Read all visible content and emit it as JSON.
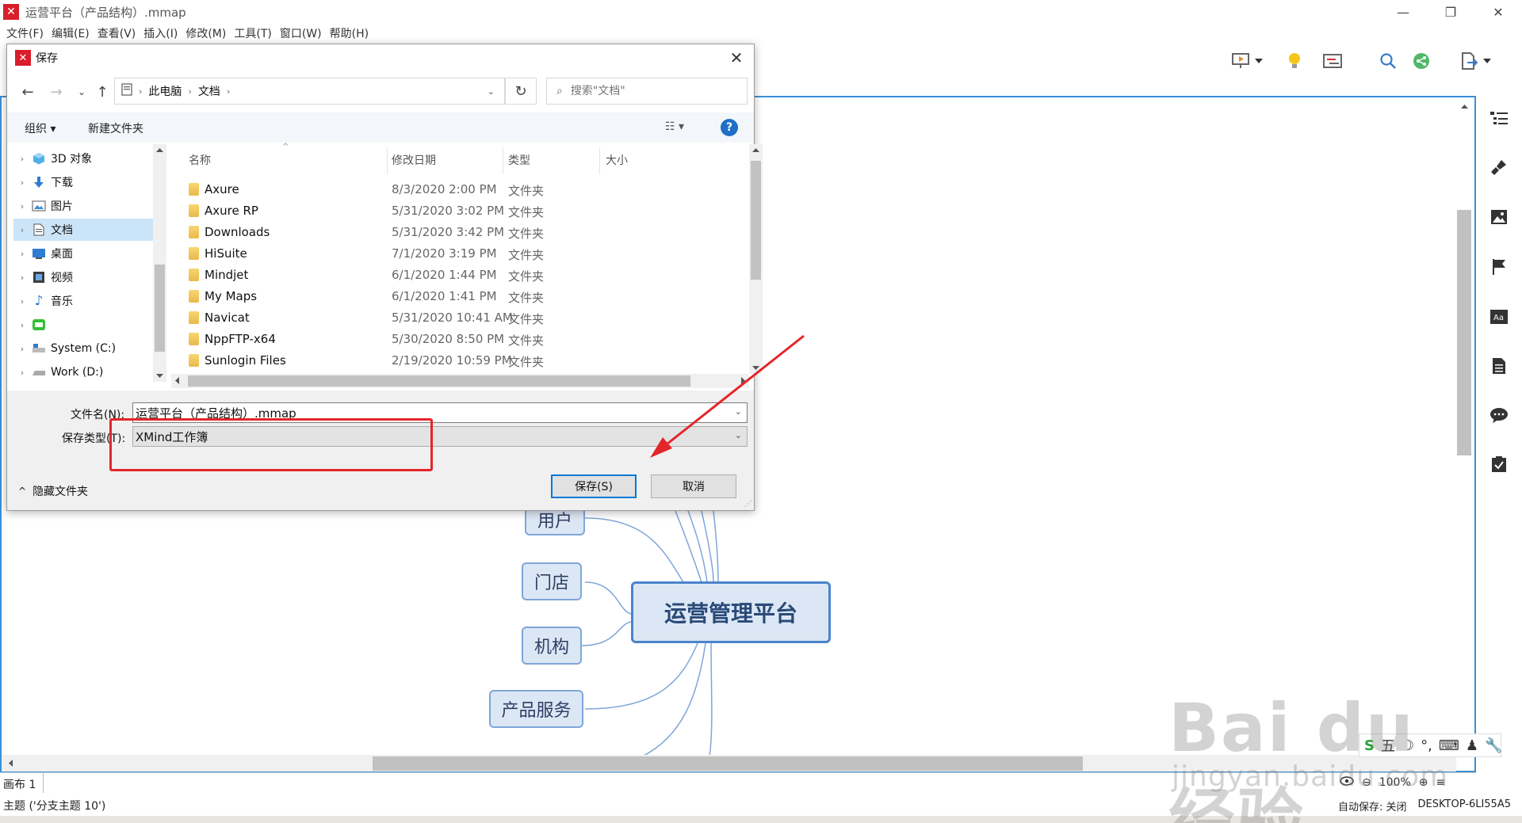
{
  "window": {
    "title": "运营平台（产品结构）.mmap",
    "minimize": "—",
    "maximize": "❐",
    "close": "✕"
  },
  "menu": [
    "文件(F)",
    "编辑(E)",
    "查看(V)",
    "插入(I)",
    "修改(M)",
    "工具(T)",
    "窗口(W)",
    "帮助(H)"
  ],
  "mindmap": {
    "central": "运营管理平台",
    "topics": [
      "用户",
      "门店",
      "机构",
      "产品服务"
    ]
  },
  "sheet": {
    "tab": "画布 1",
    "zoom": "100%"
  },
  "status": {
    "topic": "主题 ('分支主题 10')",
    "autosave": "自动保存: 关闭",
    "computer": "DESKTOP-6LI55A5"
  },
  "watermark": {
    "main": "Bai du 经验",
    "sub": "jingyan.baidu.com"
  },
  "ime": {
    "mode": "五"
  },
  "dialog": {
    "title": "保存",
    "breadcrumb": [
      "此电脑",
      "文档"
    ],
    "search_placeholder": "搜索\"文档\"",
    "organize": "组织 ▾",
    "new_folder": "新建文件夹",
    "tree": [
      {
        "label": "3D 对象",
        "icon": "cube-icon"
      },
      {
        "label": "下载",
        "icon": "download-icon"
      },
      {
        "label": "图片",
        "icon": "pictures-icon"
      },
      {
        "label": "文档",
        "icon": "documents-icon",
        "selected": true
      },
      {
        "label": "桌面",
        "icon": "desktop-icon"
      },
      {
        "label": "视频",
        "icon": "video-icon"
      },
      {
        "label": "音乐",
        "icon": "music-icon"
      },
      {
        "label": "",
        "icon": "app-drive-icon"
      },
      {
        "label": "System (C:)",
        "icon": "drive-c-icon"
      },
      {
        "label": "Work (D:)",
        "icon": "drive-d-icon"
      }
    ],
    "columns": {
      "name": "名称",
      "date": "修改日期",
      "type": "类型",
      "size": "大小"
    },
    "files": [
      {
        "name": "Axure",
        "date": "8/3/2020 2:00 PM",
        "type": "文件夹"
      },
      {
        "name": "Axure RP",
        "date": "5/31/2020 3:02 PM",
        "type": "文件夹"
      },
      {
        "name": "Downloads",
        "date": "5/31/2020 3:42 PM",
        "type": "文件夹"
      },
      {
        "name": "HiSuite",
        "date": "7/1/2020 3:19 PM",
        "type": "文件夹"
      },
      {
        "name": "Mindjet",
        "date": "6/1/2020 1:44 PM",
        "type": "文件夹"
      },
      {
        "name": "My Maps",
        "date": "6/1/2020 1:41 PM",
        "type": "文件夹"
      },
      {
        "name": "Navicat",
        "date": "5/31/2020 10:41 AM",
        "type": "文件夹"
      },
      {
        "name": "NppFTP-x64",
        "date": "5/30/2020 8:50 PM",
        "type": "文件夹"
      },
      {
        "name": "Sunlogin Files",
        "date": "2/19/2020 10:59 PM",
        "type": "文件夹"
      }
    ],
    "filename_label": "文件名(N):",
    "filename_value": "运营平台（产品结构）.mmap",
    "filetype_label": "保存类型(T):",
    "filetype_value": "XMind工作簿",
    "save_button": "保存(S)",
    "cancel_button": "取消",
    "hide_folders": "隐藏文件夹"
  },
  "colors": {
    "accent": "#0078d7",
    "annotation": "#e3262a",
    "canvas_border": "#3b8fd6",
    "node_fill": "#dce7f5",
    "node_border": "#4b84cc"
  }
}
